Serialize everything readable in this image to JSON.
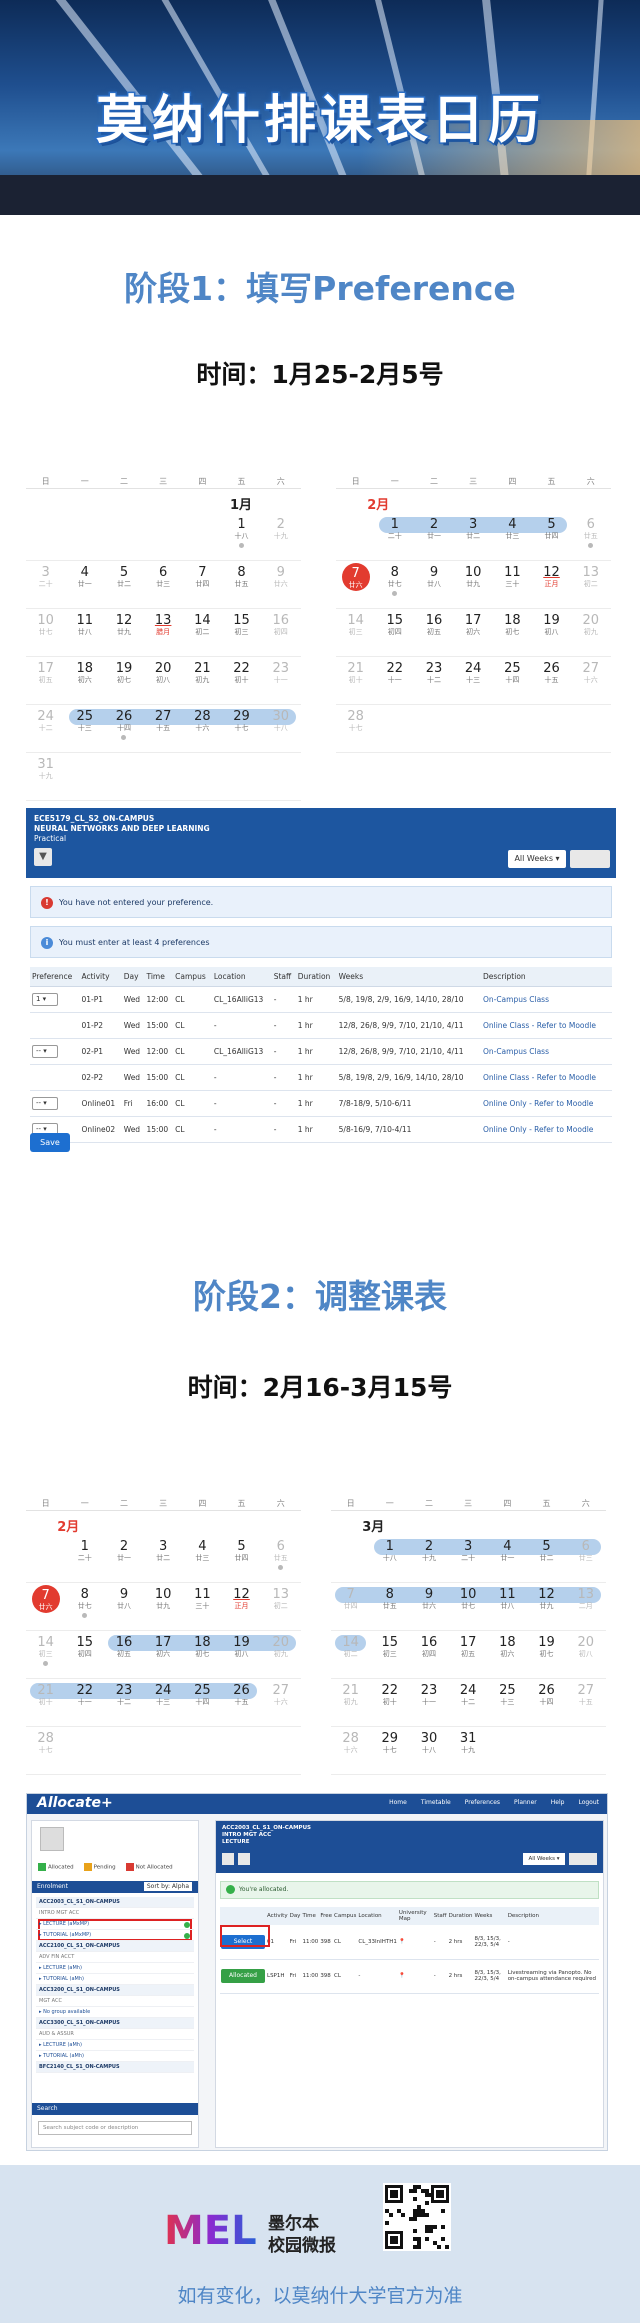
{
  "hero": {
    "title": "莫纳什排课表日历",
    "primary_color": "#2d6fc4"
  },
  "stage1": {
    "title": "阶段1：填写Preference",
    "time": "时间：1月25-2月5号"
  },
  "stage2": {
    "title": "阶段2：调整课表",
    "time": "时间：2月16-3月15号"
  },
  "weekdays": [
    "日",
    "一",
    "二",
    "三",
    "四",
    "五",
    "六"
  ],
  "calendars": {
    "jan": {
      "month": "1月",
      "rows": [
        [
          null,
          null,
          null,
          null,
          null,
          {
            "d": "1",
            "l": "十八",
            "dot": true
          },
          {
            "d": "2",
            "l": "十九",
            "m": true
          }
        ],
        [
          {
            "d": "3",
            "l": "二十",
            "m": true
          },
          {
            "d": "4",
            "l": "廿一"
          },
          {
            "d": "5",
            "l": "廿二"
          },
          {
            "d": "6",
            "l": "廿三"
          },
          {
            "d": "7",
            "l": "廿四"
          },
          {
            "d": "8",
            "l": "廿五"
          },
          {
            "d": "9",
            "l": "廿六",
            "m": true
          }
        ],
        [
          {
            "d": "10",
            "l": "廿七",
            "m": true
          },
          {
            "d": "11",
            "l": "廿八"
          },
          {
            "d": "12",
            "l": "廿九"
          },
          {
            "d": "13",
            "l": "腊月",
            "h": true
          },
          {
            "d": "14",
            "l": "初二"
          },
          {
            "d": "15",
            "l": "初三"
          },
          {
            "d": "16",
            "l": "初四",
            "m": true
          }
        ],
        [
          {
            "d": "17",
            "l": "初五",
            "m": true
          },
          {
            "d": "18",
            "l": "初六"
          },
          {
            "d": "19",
            "l": "初七"
          },
          {
            "d": "20",
            "l": "初八"
          },
          {
            "d": "21",
            "l": "初九"
          },
          {
            "d": "22",
            "l": "初十"
          },
          {
            "d": "23",
            "l": "十一",
            "m": true
          }
        ],
        [
          {
            "d": "24",
            "l": "十二",
            "m": true
          },
          {
            "d": "25",
            "l": "十三"
          },
          {
            "d": "26",
            "l": "十四",
            "dot": true
          },
          {
            "d": "27",
            "l": "十五"
          },
          {
            "d": "28",
            "l": "十六"
          },
          {
            "d": "29",
            "l": "十七"
          },
          {
            "d": "30",
            "l": "十八",
            "m": true
          }
        ],
        [
          {
            "d": "31",
            "l": "十九",
            "m": true
          },
          null,
          null,
          null,
          null,
          null,
          null
        ]
      ]
    },
    "feb1": {
      "month": "2月",
      "rows": [
        [
          null,
          {
            "d": "1",
            "l": "二十"
          },
          {
            "d": "2",
            "l": "廿一"
          },
          {
            "d": "3",
            "l": "廿二"
          },
          {
            "d": "4",
            "l": "廿三"
          },
          {
            "d": "5",
            "l": "廿四"
          },
          {
            "d": "6",
            "l": "廿五",
            "m": true,
            "dot": true
          }
        ],
        [
          {
            "d": "7",
            "l": "廿六",
            "t": true
          },
          {
            "d": "8",
            "l": "廿七",
            "dot": true
          },
          {
            "d": "9",
            "l": "廿八"
          },
          {
            "d": "10",
            "l": "廿九"
          },
          {
            "d": "11",
            "l": "三十"
          },
          {
            "d": "12",
            "l": "正月",
            "h": true
          },
          {
            "d": "13",
            "l": "初二",
            "m": true
          }
        ],
        [
          {
            "d": "14",
            "l": "初三",
            "m": true
          },
          {
            "d": "15",
            "l": "初四"
          },
          {
            "d": "16",
            "l": "初五"
          },
          {
            "d": "17",
            "l": "初六"
          },
          {
            "d": "18",
            "l": "初七"
          },
          {
            "d": "19",
            "l": "初八"
          },
          {
            "d": "20",
            "l": "初九",
            "m": true
          }
        ],
        [
          {
            "d": "21",
            "l": "初十",
            "m": true
          },
          {
            "d": "22",
            "l": "十一"
          },
          {
            "d": "23",
            "l": "十二"
          },
          {
            "d": "24",
            "l": "十三"
          },
          {
            "d": "25",
            "l": "十四"
          },
          {
            "d": "26",
            "l": "十五"
          },
          {
            "d": "27",
            "l": "十六",
            "m": true
          }
        ],
        [
          {
            "d": "28",
            "l": "十七",
            "m": true
          },
          null,
          null,
          null,
          null,
          null,
          null
        ]
      ]
    },
    "feb2": {
      "month": "2月",
      "rows": [
        [
          null,
          {
            "d": "1",
            "l": "二十"
          },
          {
            "d": "2",
            "l": "廿一"
          },
          {
            "d": "3",
            "l": "廿二"
          },
          {
            "d": "4",
            "l": "廿三"
          },
          {
            "d": "5",
            "l": "廿四"
          },
          {
            "d": "6",
            "l": "廿五",
            "m": true,
            "dot": true
          }
        ],
        [
          {
            "d": "7",
            "l": "廿六",
            "t": true
          },
          {
            "d": "8",
            "l": "廿七",
            "dot": true
          },
          {
            "d": "9",
            "l": "廿八"
          },
          {
            "d": "10",
            "l": "廿九"
          },
          {
            "d": "11",
            "l": "三十"
          },
          {
            "d": "12",
            "l": "正月",
            "h": true
          },
          {
            "d": "13",
            "l": "初二",
            "m": true
          }
        ],
        [
          {
            "d": "14",
            "l": "初三",
            "m": true,
            "dot": true
          },
          {
            "d": "15",
            "l": "初四"
          },
          {
            "d": "16",
            "l": "初五"
          },
          {
            "d": "17",
            "l": "初六"
          },
          {
            "d": "18",
            "l": "初七"
          },
          {
            "d": "19",
            "l": "初八"
          },
          {
            "d": "20",
            "l": "初九",
            "m": true
          }
        ],
        [
          {
            "d": "21",
            "l": "初十",
            "m": true
          },
          {
            "d": "22",
            "l": "十一"
          },
          {
            "d": "23",
            "l": "十二"
          },
          {
            "d": "24",
            "l": "十三"
          },
          {
            "d": "25",
            "l": "十四"
          },
          {
            "d": "26",
            "l": "十五"
          },
          {
            "d": "27",
            "l": "十六",
            "m": true
          }
        ],
        [
          {
            "d": "28",
            "l": "十七",
            "m": true
          },
          null,
          null,
          null,
          null,
          null,
          null
        ]
      ]
    },
    "mar": {
      "month": "3月",
      "rows": [
        [
          null,
          {
            "d": "1",
            "l": "十八"
          },
          {
            "d": "2",
            "l": "十九"
          },
          {
            "d": "3",
            "l": "二十"
          },
          {
            "d": "4",
            "l": "廿一"
          },
          {
            "d": "5",
            "l": "廿二"
          },
          {
            "d": "6",
            "l": "廿三",
            "m": true
          }
        ],
        [
          {
            "d": "7",
            "l": "廿四",
            "m": true
          },
          {
            "d": "8",
            "l": "廿五"
          },
          {
            "d": "9",
            "l": "廿六"
          },
          {
            "d": "10",
            "l": "廿七"
          },
          {
            "d": "11",
            "l": "廿八"
          },
          {
            "d": "12",
            "l": "廿九"
          },
          {
            "d": "13",
            "l": "二月",
            "m": true
          }
        ],
        [
          {
            "d": "14",
            "l": "初二",
            "m": true
          },
          {
            "d": "15",
            "l": "初三"
          },
          {
            "d": "16",
            "l": "初四"
          },
          {
            "d": "17",
            "l": "初五"
          },
          {
            "d": "18",
            "l": "初六"
          },
          {
            "d": "19",
            "l": "初七"
          },
          {
            "d": "20",
            "l": "初八",
            "m": true
          }
        ],
        [
          {
            "d": "21",
            "l": "初九",
            "m": true
          },
          {
            "d": "22",
            "l": "初十"
          },
          {
            "d": "23",
            "l": "十一"
          },
          {
            "d": "24",
            "l": "十二"
          },
          {
            "d": "25",
            "l": "十三"
          },
          {
            "d": "26",
            "l": "十四"
          },
          {
            "d": "27",
            "l": "十五",
            "m": true
          }
        ],
        [
          {
            "d": "28",
            "l": "十六",
            "m": true
          },
          {
            "d": "29",
            "l": "十七"
          },
          {
            "d": "30",
            "l": "十八"
          },
          {
            "d": "31",
            "l": "十九"
          },
          null,
          null,
          null
        ]
      ]
    }
  },
  "preference_panel": {
    "unit_code": "ECE5179_CL_S2_ON-CAMPUS",
    "unit_name": "NEURAL NETWORKS AND DEEP LEARNING",
    "activity_type": "Practical",
    "weeks_select": "All Weeks",
    "alert_error": "You have not entered your preference.",
    "alert_info": "You must enter at least 4 preferences",
    "columns": [
      "Preference",
      "Activity",
      "Day",
      "Time",
      "Campus",
      "Location",
      "Staff",
      "Duration",
      "Weeks",
      "Description"
    ],
    "rows": [
      {
        "pref": "1",
        "activity": "01-P1",
        "day": "Wed",
        "time": "12:00",
        "campus": "CL",
        "location": "CL_16AlliG13",
        "staff": "-",
        "duration": "1 hr",
        "weeks": "5/8, 19/8, 2/9, 16/9, 14/10, 28/10",
        "desc": "On-Campus Class"
      },
      {
        "pref": "",
        "activity": "01-P2",
        "day": "Wed",
        "time": "15:00",
        "campus": "CL",
        "location": "-",
        "staff": "-",
        "duration": "1 hr",
        "weeks": "12/8, 26/8, 9/9, 7/10, 21/10, 4/11",
        "desc": "Online Class - Refer to Moodle"
      },
      {
        "pref": "--",
        "activity": "02-P1",
        "day": "Wed",
        "time": "12:00",
        "campus": "CL",
        "location": "CL_16AlliG13",
        "staff": "-",
        "duration": "1 hr",
        "weeks": "12/8, 26/8, 9/9, 7/10, 21/10, 4/11",
        "desc": "On-Campus Class"
      },
      {
        "pref": "",
        "activity": "02-P2",
        "day": "Wed",
        "time": "15:00",
        "campus": "CL",
        "location": "-",
        "staff": "-",
        "duration": "1 hr",
        "weeks": "5/8, 19/8, 2/9, 16/9, 14/10, 28/10",
        "desc": "Online Class - Refer to Moodle"
      },
      {
        "pref": "--",
        "activity": "Online01",
        "day": "Fri",
        "time": "16:00",
        "campus": "CL",
        "location": "-",
        "staff": "-",
        "duration": "1 hr",
        "weeks": "7/8-18/9, 5/10-6/11",
        "desc": "Online Only - Refer to Moodle"
      },
      {
        "pref": "--",
        "activity": "Online02",
        "day": "Wed",
        "time": "15:00",
        "campus": "CL",
        "location": "-",
        "staff": "-",
        "duration": "1 hr",
        "weeks": "5/8-16/9, 7/10-4/11",
        "desc": "Online Only - Refer to Moodle"
      }
    ],
    "save_label": "Save"
  },
  "allocate_panel": {
    "brand": "Allocate+",
    "nav": [
      "Home",
      "Timetable",
      "Preferences",
      "Planner",
      "Help",
      "Logout"
    ],
    "legend": [
      "Allocated",
      "Pending",
      "Not Allocated"
    ],
    "enrolment_label": "Enrolment",
    "sort_label": "Sort by: Alpha",
    "enrolment_items": [
      {
        "text": "ACC2003_CL_S1_ON-CAMPUS",
        "kind": "code"
      },
      {
        "text": "INTRO MGT ACC",
        "kind": "sub"
      },
      {
        "text": "▸ LECTURE (aMxMP)",
        "kind": "act",
        "ok": true
      },
      {
        "text": "▸ TUTORIAL (aMxMP)",
        "kind": "act",
        "ok": true
      },
      {
        "text": "ACC2100_CL_S1_ON-CAMPUS",
        "kind": "code"
      },
      {
        "text": "ADV FIN ACCT",
        "kind": "sub"
      },
      {
        "text": "▸ LECTURE (aMh)",
        "kind": "act"
      },
      {
        "text": "▸ TUTORIAL (aMh)",
        "kind": "act"
      },
      {
        "text": "ACC3200_CL_S1_ON-CAMPUS",
        "kind": "code"
      },
      {
        "text": "MGT ACC",
        "kind": "sub"
      },
      {
        "text": "▸ No group available",
        "kind": "act"
      },
      {
        "text": "ACC3300_CL_S1_ON-CAMPUS",
        "kind": "code"
      },
      {
        "text": "AUD & ASSUR",
        "kind": "sub"
      },
      {
        "text": "▸ LECTURE (aMh)",
        "kind": "act"
      },
      {
        "text": "▸ TUTORIAL (aMh)",
        "kind": "act"
      },
      {
        "text": "BFC2140_CL_S1_ON-CAMPUS",
        "kind": "code"
      }
    ],
    "search_label": "Search",
    "search_placeholder": "Search subject code or description",
    "right_unit_code": "ACC2003_CL_S1_ON-CAMPUS",
    "right_unit_name": "INTRO MGT ACC",
    "right_activity": "LECTURE",
    "weeks_select": "All Weeks",
    "alloc_alert": "You're allocated.",
    "columns": [
      "",
      "Activity",
      "Day",
      "Time",
      "Free",
      "Campus",
      "Location",
      "University Map",
      "Staff",
      "Duration",
      "Weeks",
      "Description"
    ],
    "rows": [
      {
        "action": "Select",
        "activity": "01",
        "day": "Fri",
        "time": "11:00",
        "free": "398",
        "campus": "CL",
        "location": "CL_33InIHTH1",
        "staff": "-",
        "duration": "2 hrs",
        "weeks": "8/3, 15/3, 22/3, 5/4",
        "desc": "-"
      },
      {
        "action": "Allocated",
        "activity": "LSP1H",
        "day": "Fri",
        "time": "11:00",
        "free": "398",
        "campus": "CL",
        "location": "-",
        "staff": "-",
        "duration": "2 hrs",
        "weeks": "8/3, 15/3, 22/3, 5/4",
        "desc": "Livestreaming via Panopto. No on-campus attendance required"
      }
    ]
  },
  "footer": {
    "logo_text_1": "墨尔本",
    "logo_text_2": "校园微报",
    "note": "如有变化，以莫纳什大学官方为准"
  }
}
